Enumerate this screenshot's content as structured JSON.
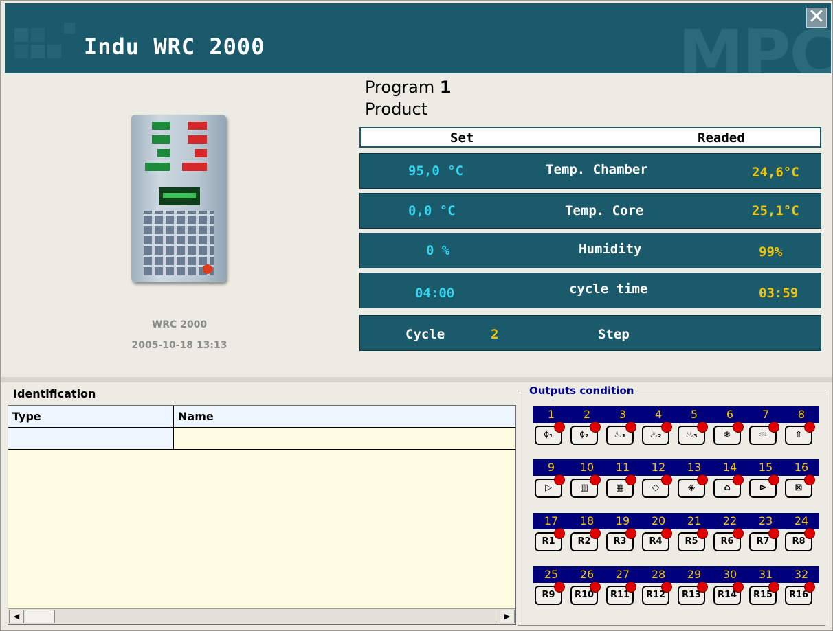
{
  "window": {
    "title": "Indu WRC 2000",
    "close_glyph": "✕",
    "watermark": "MPC"
  },
  "device": {
    "model": "WRC 2000",
    "datetime": "2005-10-18 13:13"
  },
  "program": {
    "program_label": "Program",
    "program_number": "1",
    "product_label": "Product"
  },
  "table": {
    "set_header": "Set",
    "readed_header": "Readed",
    "rows": [
      {
        "set": "95,0 °C",
        "label": "Temp. Chamber",
        "read": "24,6°C"
      },
      {
        "set": "0,0 °C",
        "label": "Temp. Core",
        "read": "25,1°C"
      },
      {
        "set": "0 %",
        "label": "Humidity",
        "read": "99%"
      },
      {
        "set": "04:00",
        "label": "cycle time",
        "read": "03:59"
      }
    ],
    "cycle_label": "Cycle",
    "cycle_value": "2",
    "step_label": "Step"
  },
  "identification": {
    "title": "Identification",
    "col_type": "Type",
    "col_name": "Name"
  },
  "outputs": {
    "title": "Outputs condition",
    "numbers": [
      [
        "1",
        "2",
        "3",
        "4",
        "5",
        "6",
        "7",
        "8"
      ],
      [
        "9",
        "10",
        "11",
        "12",
        "13",
        "14",
        "15",
        "16"
      ],
      [
        "17",
        "18",
        "19",
        "20",
        "21",
        "22",
        "23",
        "24"
      ],
      [
        "25",
        "26",
        "27",
        "28",
        "29",
        "30",
        "31",
        "32"
      ]
    ],
    "relay_row3": [
      "R1",
      "R2",
      "R3",
      "R4",
      "R5",
      "R6",
      "R7",
      "R8"
    ],
    "relay_row4": [
      "R9",
      "R10",
      "R11",
      "R12",
      "R13",
      "R14",
      "R15",
      "R16"
    ],
    "icons_row1": [
      "fan-1-icon",
      "fan-2-icon",
      "heater-1-icon",
      "heater-2-icon",
      "heater-3-icon",
      "cooling-icon",
      "steam-icon",
      "door-icon"
    ],
    "icons_row2": [
      "vent-icon",
      "humidifier-icon",
      "dehumidifier-icon",
      "flap-1-icon",
      "flap-2-icon",
      "sprinkler-icon",
      "valve-icon",
      "drain-icon"
    ],
    "colors": {
      "active_dot": "#e00000",
      "band": "#00007a",
      "number": "#f5c400"
    }
  }
}
